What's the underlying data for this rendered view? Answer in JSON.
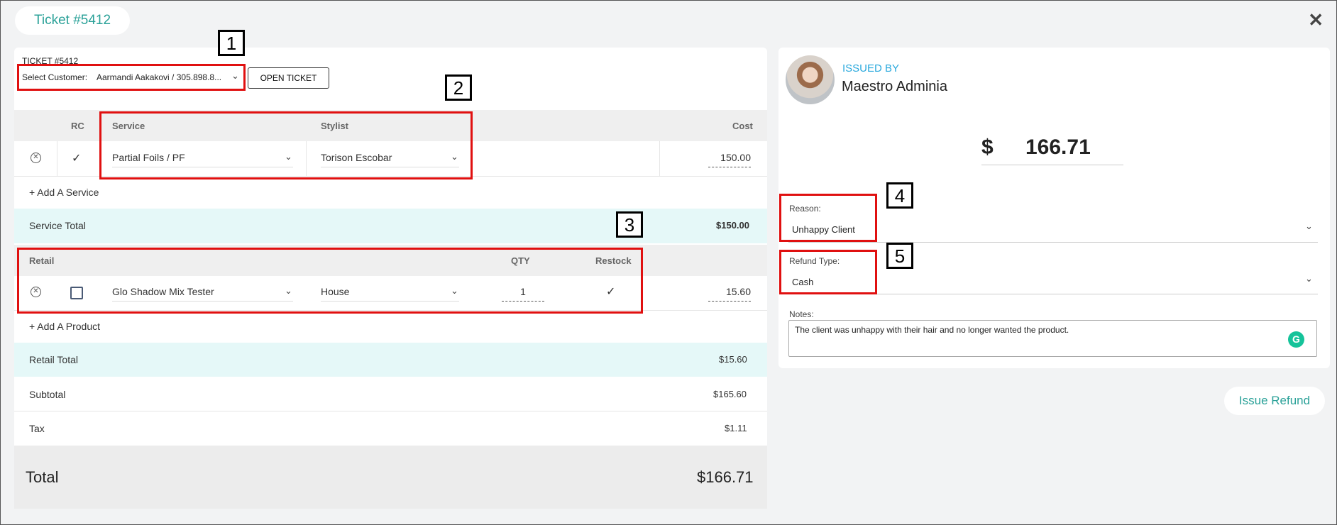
{
  "header": {
    "ticket_title": "Ticket #5412",
    "close_glyph": "✕"
  },
  "customer": {
    "ticket_label": "TICKET #5412",
    "select_label": "Select Customer:",
    "select_value": "Aarmandi Aakakovi / 305.898.8...",
    "open_button": "OPEN TICKET"
  },
  "services": {
    "headers": {
      "rc": "RC",
      "service": "Service",
      "stylist": "Stylist",
      "cost": "Cost"
    },
    "row": {
      "service": "Partial Foils / PF",
      "stylist": "Torison Escobar",
      "cost": "150.00",
      "rc_checked": true
    },
    "add_label": "+ Add A Service",
    "total_label": "Service Total",
    "total_value": "$150.00"
  },
  "retail": {
    "headers": {
      "retail": "Retail",
      "qty": "QTY",
      "restock": "Restock"
    },
    "row": {
      "product": "Glo Shadow Mix Tester",
      "source": "House",
      "qty": "1",
      "cost": "15.60",
      "restock_checked": true
    },
    "add_label": "+ Add A Product",
    "total_label": "Retail Total",
    "total_value": "$15.60"
  },
  "summary": {
    "subtotal_label": "Subtotal",
    "subtotal_value": "$165.60",
    "tax_label": "Tax",
    "tax_value": "$1.11",
    "total_label": "Total",
    "total_value": "$166.71"
  },
  "refund": {
    "issued_by_label": "ISSUED BY",
    "issuer_name": "Maestro Adminia",
    "currency": "$",
    "amount": "166.71",
    "reason_label": "Reason:",
    "reason_value": "Unhappy Client",
    "refund_type_label": "Refund Type:",
    "refund_type_value": "Cash",
    "notes_label": "Notes:",
    "notes_value": "The client was unhappy with their hair and no longer wanted the product.",
    "issue_button": "Issue Refund"
  },
  "annotations": [
    "1",
    "2",
    "3",
    "4",
    "5"
  ],
  "colors": {
    "accent": "#2aa198",
    "link_blue": "#2aa9dd",
    "annotation_red": "#e01010",
    "band": "#e5f8f8"
  }
}
